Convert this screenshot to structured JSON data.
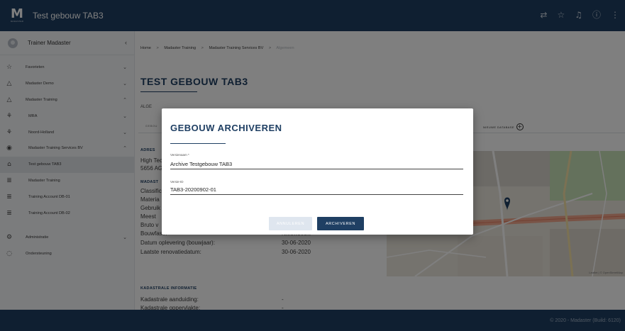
{
  "app": {
    "logo_letter": "M",
    "logo_sub": "MADASTER",
    "title": "Test gebouw TAB3",
    "icons": [
      "share-icon",
      "star-icon",
      "bell-icon",
      "info-icon",
      "more-icon"
    ],
    "icon_glyphs": [
      "⇄",
      "☆",
      "♫",
      "ⓘ",
      "⋮"
    ]
  },
  "sidebar": {
    "user": "Trainer Madaster",
    "collapse_glyph": "‹",
    "items": [
      {
        "icon": "☆",
        "icon_name": "star-icon",
        "label": "Favorieten",
        "chev": "⌄"
      },
      {
        "icon": "△",
        "icon_name": "triangle-icon",
        "label": "Madaster Demo",
        "chev": "⌄"
      },
      {
        "icon": "△",
        "icon_name": "triangle-icon",
        "label": "Madaster Training",
        "chev": "⌃"
      },
      {
        "icon": "⚘",
        "icon_name": "org-icon",
        "label": "MRA",
        "chev": "⌄"
      },
      {
        "icon": "⚘",
        "icon_name": "org-icon",
        "label": "Noord-Holland",
        "chev": "⌄"
      },
      {
        "icon": "◉",
        "icon_name": "company-icon",
        "label": "Madaster Training Services BV",
        "chev": "⌃"
      },
      {
        "icon": "⌂",
        "icon_name": "building-icon",
        "label": "Test gebouw TAB3",
        "chev": ""
      },
      {
        "icon": "≣",
        "icon_name": "database-icon",
        "label": "Madaster Training",
        "chev": ""
      },
      {
        "icon": "≣",
        "icon_name": "database-icon",
        "label": "Training Account DB-01",
        "chev": ""
      },
      {
        "icon": "≣",
        "icon_name": "database-icon",
        "label": "Training Account DB-02",
        "chev": ""
      },
      {
        "icon": "⚙",
        "icon_name": "admin-icon",
        "label": "Administratie",
        "chev": "⌄"
      },
      {
        "icon": "◌",
        "icon_name": "support-icon",
        "label": "Ondersteuning",
        "chev": ""
      }
    ]
  },
  "breadcrumb": {
    "items": [
      "Home",
      "Madaster Training",
      "Madaster Training Services BV"
    ],
    "current": "Algemeen",
    "sep": ">"
  },
  "page": {
    "title": "TEST GEBOUW TAB3",
    "tab_label": "ALGE",
    "subtab_label": "GEBOU",
    "new_dataset_label": "NIEUWE DATABASE",
    "new_dataset_glyph": "+"
  },
  "details": {
    "address_header": "ADRES",
    "address_line1": "High Tec",
    "address_line2": "5656 AG",
    "madaster_header": "MADAST",
    "classific": "Classific",
    "materia": "Materia",
    "gebruik": "Gebruik",
    "meest": "Meest",
    "bruto": "Bruto v",
    "bouwfase_label": "Bouwfase:",
    "bouwfase_value": "Nieuwbouw",
    "oplevering_label": "Datum oplevering (bouwjaar):",
    "oplevering_value": "30-06-2020",
    "renovatie_label": "Laatste renovatiedatum:",
    "renovatie_value": "30-06-2020",
    "kadastrale_header": "KADASTRALE INFORMATIE",
    "aanduiding_label": "Kadastrale aanduiding:",
    "aanduiding_value": "-",
    "oppervlakte_label": "Kadastrale oppervlakte:",
    "oppervlakte_value": "-"
  },
  "map": {
    "attribution": "Leaflet | © OpenStreetMap"
  },
  "dialog": {
    "title": "GEBOUW ARCHIVEREN",
    "version_label": "Versienaam *",
    "version_value": "Archive Testgebouw TAB3",
    "id_label": "Versie-ID",
    "id_value": "TAB3-20200902-01",
    "cancel_label": "ANNULEREN",
    "archive_label": "ARCHIVEREN"
  },
  "footer": {
    "text": "© 2020 - Madaster (Build: 6120)"
  },
  "colors": {
    "primary": "#1f3f63",
    "cancel_disabled": "#dfe6ef"
  }
}
